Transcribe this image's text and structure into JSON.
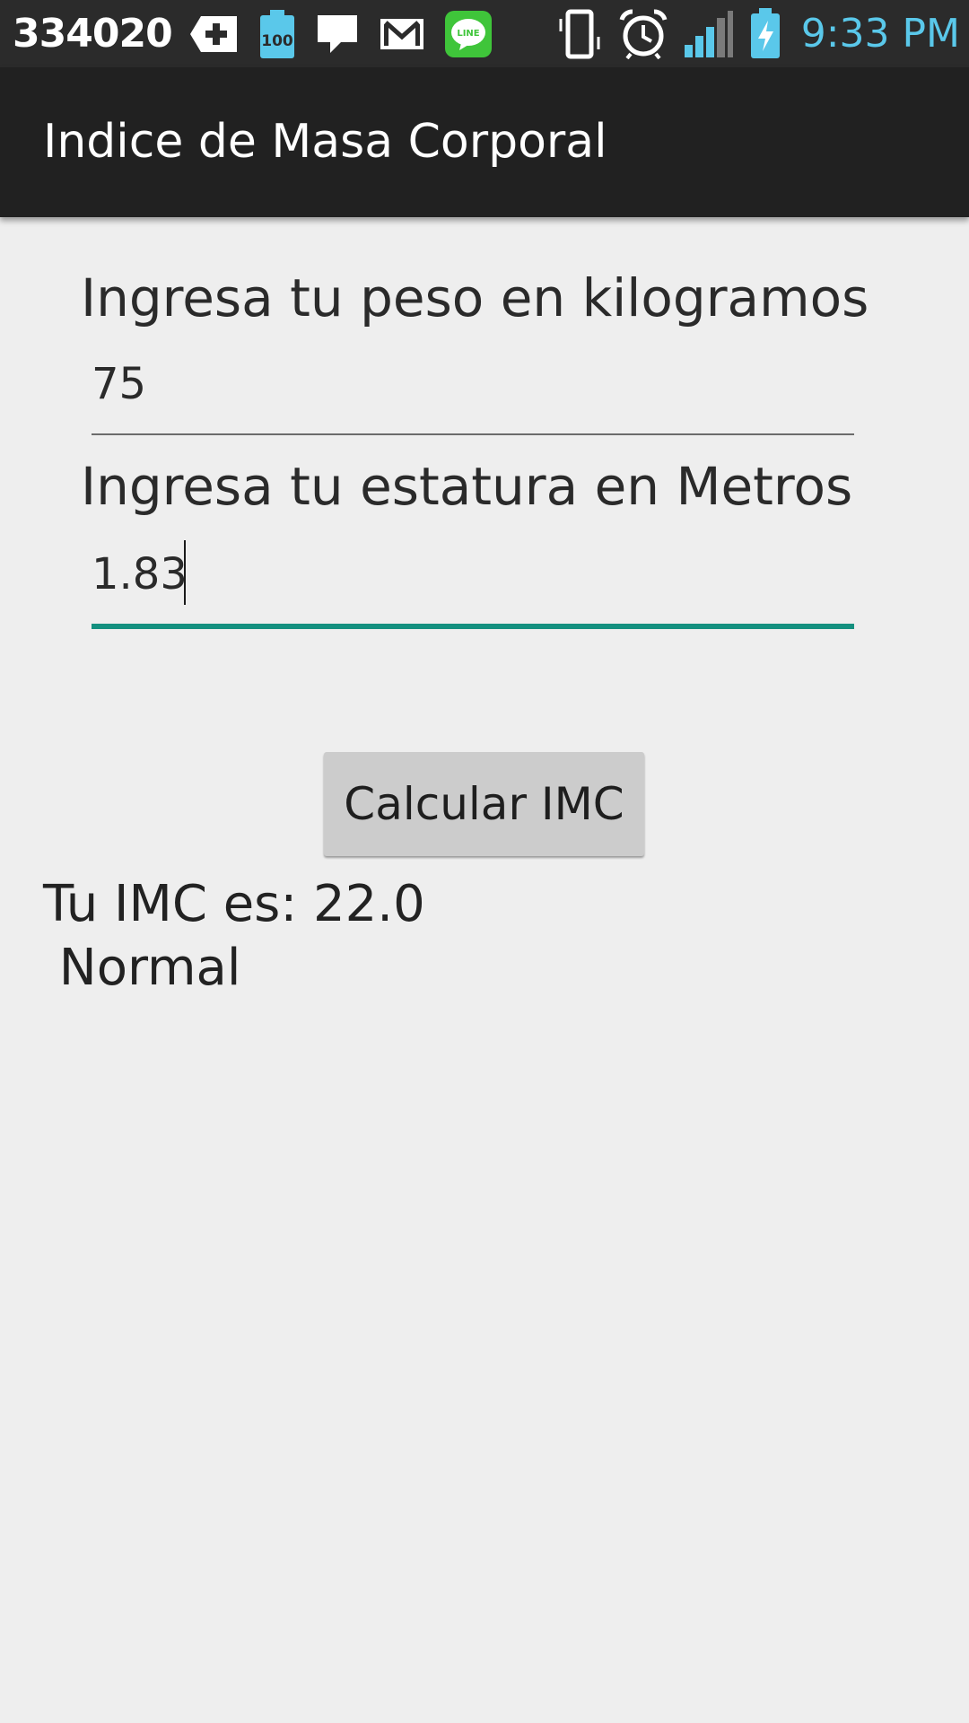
{
  "status_bar": {
    "left_text": "334020",
    "icons_left": [
      "medical-plus-icon",
      "battery-100-icon",
      "chat-bubble-icon",
      "gmail-icon",
      "line-app-icon"
    ],
    "icons_right": [
      "vibrate-icon",
      "alarm-icon",
      "signal-icon",
      "battery-charging-icon"
    ],
    "time": "9:33 PM",
    "battery_badge": "100",
    "line_badge": "LINE",
    "time_color": "#5ac8ea"
  },
  "app_bar": {
    "title": "Indice de Masa Corporal"
  },
  "form": {
    "weight_label": "Ingresa tu peso en kilogramos",
    "weight_value": "75",
    "height_label": "Ingresa tu estatura en Metros",
    "height_value": "1.83",
    "focus_color": "#14907f"
  },
  "actions": {
    "calculate_label": "Calcular IMC"
  },
  "result": {
    "line1": "Tu IMC es: 22.0",
    "line2": " Normal"
  }
}
